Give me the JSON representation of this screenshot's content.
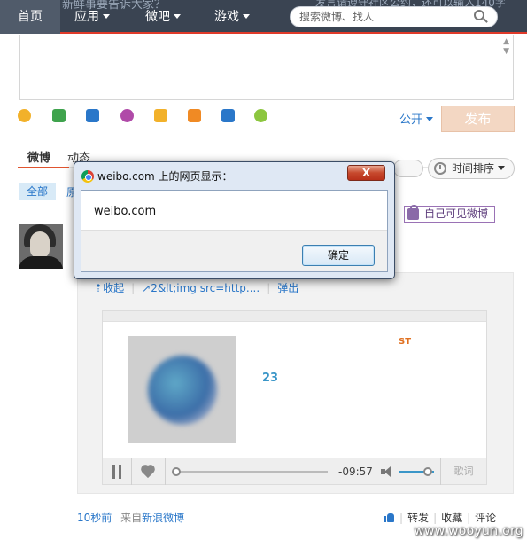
{
  "nav": {
    "home": "首页",
    "apps": "应用",
    "weiba": "微吧",
    "games": "游戏",
    "search_placeholder": "搜索微博、找人"
  },
  "composer": {
    "scope": "公开",
    "publish": "发布"
  },
  "toolbar_icons": [
    {
      "name": "emoji-icon",
      "color": "#f2b12a"
    },
    {
      "name": "image-icon",
      "color": "#3fa34d"
    },
    {
      "name": "video-icon",
      "color": "#2a77c9"
    },
    {
      "name": "music-icon",
      "color": "#b04aa8"
    },
    {
      "name": "topic-icon",
      "color": "#f2b12a"
    },
    {
      "name": "vote-icon",
      "color": "#f08a24"
    },
    {
      "name": "long-weibo-icon",
      "color": "#2a77c9"
    },
    {
      "name": "more-icon",
      "color": "#8cc63f"
    }
  ],
  "tabs": {
    "weibo": "微博",
    "dongtai": "动态"
  },
  "sort": "时间排序",
  "filters": {
    "all": "全部",
    "original": "原"
  },
  "private_badge": "自己可见微博",
  "retweet_links": {
    "collapse": "收起",
    "link": "2&lt;img src=http....",
    "popup": "弹出"
  },
  "music": {
    "title": "23",
    "tag": "ST",
    "time_left": "-09:57",
    "progress": 0.0,
    "volume": 0.8,
    "lyrics": "歌词"
  },
  "post": {
    "time": "10秒前",
    "source_prefix": "来自",
    "source": "新浪微博"
  },
  "actions": {
    "repost": "转发",
    "favorite": "收藏",
    "comment": "评论"
  },
  "dialog": {
    "title": "weibo.com 上的网页显示：",
    "close": "X",
    "message": "weibo.com",
    "ok": "确定"
  },
  "behind_text": {
    "left": "新鲜事要告诉大家？",
    "right": "发言请遵守社区公约，还可以输入140字"
  },
  "watermark": "www.wooyun.org",
  "colors": {
    "nav_bg": "#3a4452",
    "accent_red": "#e03a2a",
    "link_blue": "#2a77c9",
    "publish_disabled": "#f3d7c3"
  }
}
